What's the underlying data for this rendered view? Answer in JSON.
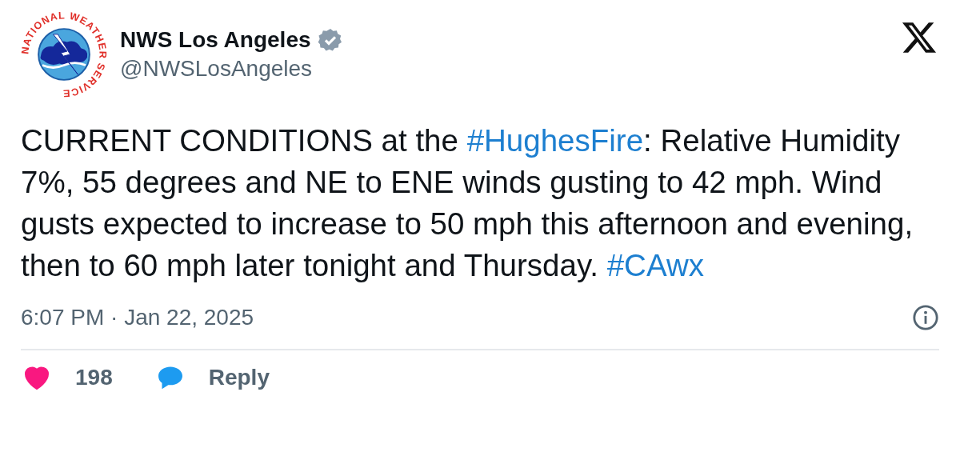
{
  "author": {
    "logo_text": "NATIONAL WEATHER SERVICE",
    "name": "NWS Los Angeles",
    "verified": true,
    "handle": "@NWSLosAngeles"
  },
  "post": {
    "parts": [
      {
        "kind": "plain",
        "text": "CURRENT CONDITIONS at the "
      },
      {
        "kind": "hashtag",
        "text": "#HughesFire"
      },
      {
        "kind": "plain",
        "text": ": Relative Humidity 7%, 55 degrees and NE to ENE winds gusting to 42 mph. Wind gusts expected to increase to 50 mph this afternoon and evening, then to 60 mph later tonight and Thursday. "
      },
      {
        "kind": "hashtag",
        "text": "#CAwx"
      }
    ],
    "timestamp": "6:07 PM · Jan 22, 2025"
  },
  "actions": {
    "likes": "198",
    "liked": true,
    "reply": "Reply"
  }
}
